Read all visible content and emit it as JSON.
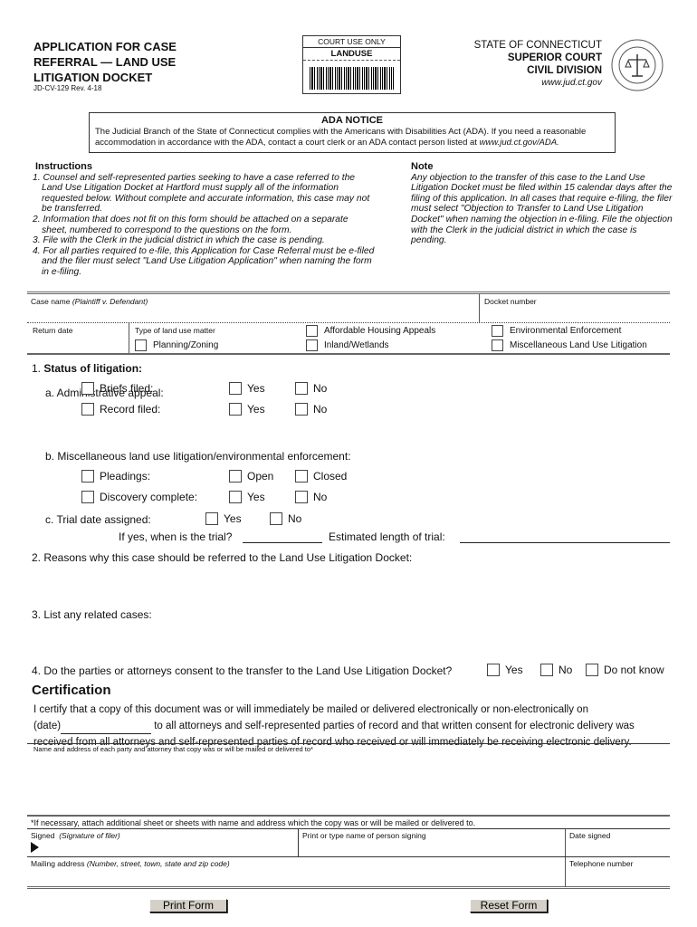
{
  "header": {
    "title_lines": [
      "APPLICATION FOR CASE",
      "REFERRAL — LAND USE",
      "LITIGATION DOCKET"
    ],
    "form_number": "JD-CV-129   Rev. 4-18",
    "court_use_label": "COURT USE ONLY",
    "court_use_value": "LANDUSE",
    "state": "STATE OF CONNECTICUT",
    "court": "SUPERIOR COURT",
    "division": "CIVIL DIVISION",
    "website": "www.jud.ct.gov",
    "seal_icon": "state-seal-icon"
  },
  "ada": {
    "title": "ADA NOTICE",
    "text": "The Judicial Branch of the State of Connecticut complies with the Americans with Disabilities Act (ADA). If you need a reasonable accommodation in accordance with the ADA, contact a court clerk or an ADA contact person listed at ",
    "link": "www.jud.ct.gov/ADA."
  },
  "instructions": {
    "title": "Instructions",
    "items": [
      "1. Counsel and self-represented parties seeking to have a case referred to the Land Use Litigation Docket at Hartford must supply all of the information requested below. Without complete and accurate information, this case may not be transferred.",
      "2. Information that does not fit on this form should be attached on a separate sheet, numbered to correspond to the questions on the form.",
      "3. File with the Clerk in the judicial district in which the case is pending.",
      "4. For all parties required to e-file, this Application for Case Referral must be e-filed and the filer must select \"Land Use Litigation Application\" when naming the form in e-filing."
    ]
  },
  "note": {
    "title": "Note",
    "text": "Any objection to the transfer of this case to the Land Use Litigation Docket must be filed within 15 calendar days after the filing of this application. In all cases that require e-filing, the filer must select \"Objection to Transfer to Land Use Litigation Docket\" when naming the objection in e-filing. File the objection with the Clerk in the judicial district in which the case is pending."
  },
  "case": {
    "case_name_label": "Case name",
    "case_name_hint": "(Plaintiff v. Defendant)",
    "case_name_value": "",
    "docket_label": "Docket number",
    "docket_value": "",
    "return_date_label": "Return date",
    "return_date_value": "",
    "type_label": "Type of land use matter",
    "types": [
      {
        "label": "Planning/Zoning",
        "checked": false
      },
      {
        "label": "Affordable Housing Appeals",
        "checked": false
      },
      {
        "label": "Inland/Wetlands",
        "checked": false
      },
      {
        "label": "Environmental Enforcement",
        "checked": false
      },
      {
        "label": "Miscellaneous Land Use Litigation",
        "checked": false
      }
    ]
  },
  "section1": {
    "number": "1.",
    "title": "Status of litigation:",
    "a_label": "a. Administrative appeal:",
    "briefs": "Briefs filed:",
    "record": "Record filed:",
    "b_label": "b. Miscellaneous land use litigation/environmental enforcement:",
    "pleadings": "Pleadings:",
    "discovery": "Discovery complete:",
    "c_label": "c. Trial date assigned:",
    "when": "If yes, when is the trial?",
    "length": "Estimated length of trial:",
    "yes": "Yes",
    "no": "No",
    "open": "Open",
    "closed": "Closed"
  },
  "section2": {
    "label": "2. Reasons why this case should be referred to the Land Use Litigation Docket:"
  },
  "section3": {
    "label": "3. List any related cases:"
  },
  "section4": {
    "label": "4. Do the parties or attorneys consent to the transfer to the Land Use Litigation Docket?",
    "yes": "Yes",
    "no": "No",
    "unknown": "Do not know"
  },
  "certification": {
    "title": "Certification",
    "line1": "I certify that a copy of this document was or will immediately be mailed or delivered electronically or non-electronically on",
    "date_prefix": "(date)",
    "line2": " to all attorneys and self-represented parties of record and that written consent for electronic delivery was",
    "line3": "received from all attorneys and self-represented parties of record who received or will immediately be receiving electronic delivery.",
    "names_label": "Name and address of each party and attorney that copy was or will be mailed or delivered to*",
    "attach_note": "*If necessary, attach additional sheet or sheets with name and address which the copy was or will be mailed or delivered to.",
    "signed_label": "Signed",
    "signed_hint": "(Signature of filer)",
    "print_name_label": "Print or type name of person signing",
    "date_signed_label": "Date signed",
    "mailing_label": "Mailing address",
    "mailing_hint": "(Number, street, town, state and zip code)",
    "phone_label": "Telephone number"
  },
  "buttons": {
    "print": "Print Form",
    "reset": "Reset Form"
  }
}
